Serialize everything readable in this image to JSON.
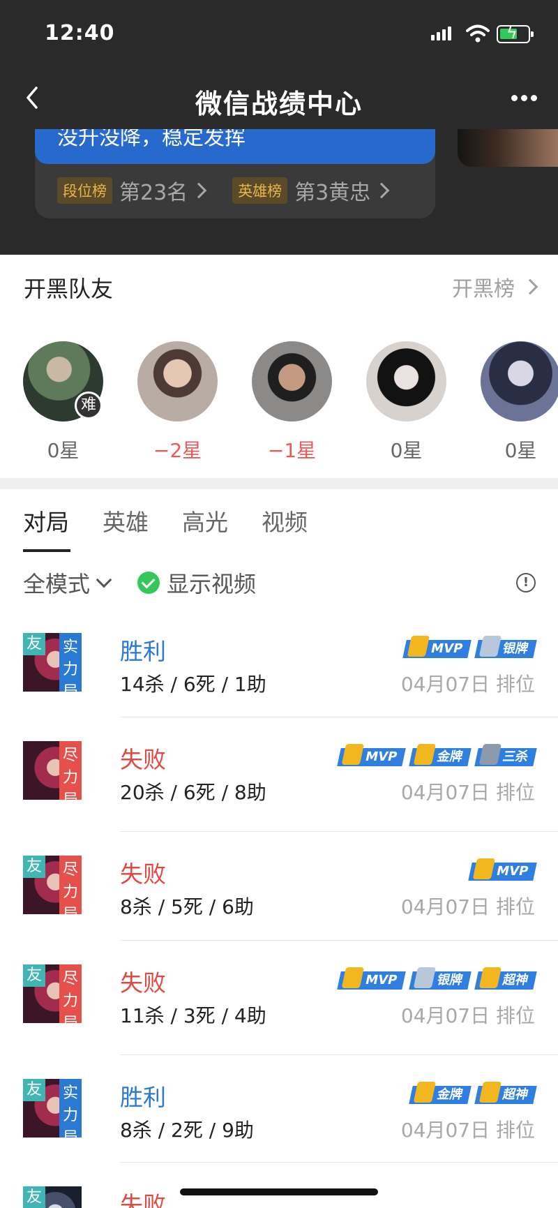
{
  "status": {
    "time": "12:40"
  },
  "nav": {
    "title": "微信战绩中心"
  },
  "card": {
    "banner": "没升没降，稳定发挥",
    "rank_tag": "段位榜",
    "rank_value": "第23名",
    "hero_tag": "英雄榜",
    "hero_value": "第3黄忠"
  },
  "team": {
    "title": "开黑队友",
    "link": "开黑榜",
    "mates": [
      {
        "stars": "0星",
        "badge": "难"
      },
      {
        "stars": "−2星"
      },
      {
        "stars": "−1星"
      },
      {
        "stars": "0星"
      },
      {
        "stars": "0星"
      }
    ]
  },
  "tabs": [
    "对局",
    "英雄",
    "高光",
    "视频"
  ],
  "filters": {
    "mode": "全模式",
    "show_video": "显示视频",
    "info": "!"
  },
  "matches": [
    {
      "tag": "友",
      "mode": [
        "实",
        "力",
        "局"
      ],
      "result": "胜利",
      "kda": "14杀 / 6死 / 1助",
      "meta": "04月07日 排位",
      "badges": [
        "MVP",
        "银牌"
      ]
    },
    {
      "tag": "",
      "mode": [
        "尽",
        "力",
        "局"
      ],
      "result": "失败",
      "kda": "20杀 / 6死 / 8助",
      "meta": "04月07日 排位",
      "badges": [
        "MVP",
        "金牌",
        "三杀"
      ]
    },
    {
      "tag": "友",
      "mode": [
        "尽",
        "力",
        "局"
      ],
      "result": "失败",
      "kda": "8杀 / 5死 / 6助",
      "meta": "04月07日 排位",
      "badges": [
        "MVP"
      ]
    },
    {
      "tag": "友",
      "mode": [
        "尽",
        "力",
        "局"
      ],
      "result": "失败",
      "kda": "11杀 / 3死 / 4助",
      "meta": "04月07日 排位",
      "badges": [
        "MVP",
        "银牌",
        "超神"
      ]
    },
    {
      "tag": "友",
      "mode": [
        "实",
        "力",
        "局"
      ],
      "result": "胜利",
      "kda": "8杀 / 2死 / 9助",
      "meta": "04月07日 排位",
      "badges": [
        "金牌",
        "超神"
      ]
    },
    {
      "tag": "友",
      "mode": [],
      "result": "失败",
      "kda": "",
      "meta": "",
      "badges": []
    }
  ],
  "colors": {
    "win": "#2a7ad4",
    "loss": "#e04a42",
    "accent_green": "#35c759",
    "badge_blue": "#2f7fe0"
  }
}
